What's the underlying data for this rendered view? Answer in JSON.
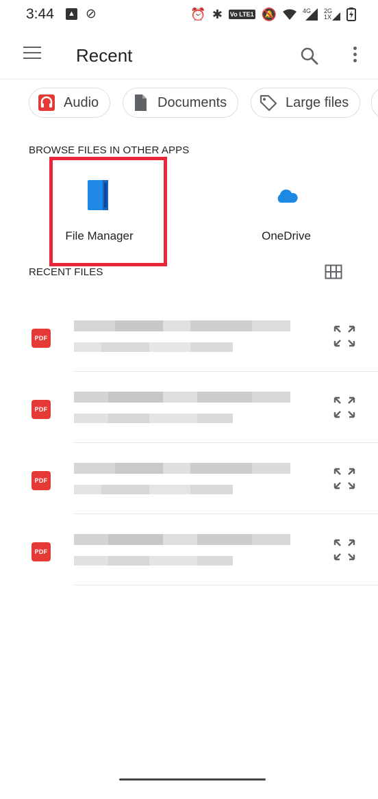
{
  "status_bar": {
    "time": "3:44",
    "left_icons": [
      "gallery-icon",
      "link-icon"
    ],
    "right_icons": [
      "alarm-icon",
      "bluetooth-vibrate-icon",
      "volte-icon",
      "mute-icon",
      "wifi-icon",
      "signal-4g-icon",
      "signal-2g-icon",
      "battery-charging-icon"
    ],
    "lte_label": "Vo LTE1",
    "net1": "4G",
    "net2": "2G",
    "net2_sub": "1X"
  },
  "toolbar": {
    "title": "Recent",
    "menu_icon": "hamburger-menu-icon",
    "search_icon": "search-icon",
    "more_icon": "more-vert-icon"
  },
  "chips": [
    {
      "label": "Audio",
      "icon": "headphones-icon",
      "color": "#e53935"
    },
    {
      "label": "Documents",
      "icon": "document-icon",
      "color": "#5f6368"
    },
    {
      "label": "Large files",
      "icon": "tag-icon",
      "color": "#5f6368"
    }
  ],
  "browse_section": {
    "title": "BROWSE FILES IN OTHER APPS",
    "apps": [
      {
        "label": "File Manager",
        "icon": "file-manager-icon",
        "color": "#1e88e5"
      },
      {
        "label": "OneDrive",
        "icon": "onedrive-cloud-icon",
        "color": "#1e88e5"
      }
    ]
  },
  "recent_section": {
    "title": "RECENT FILES",
    "grid_icon": "grid-view-icon"
  },
  "files": [
    {
      "type_badge": "PDF"
    },
    {
      "type_badge": "PDF"
    },
    {
      "type_badge": "PDF"
    },
    {
      "type_badge": "PDF"
    }
  ],
  "colors": {
    "accent_red": "#e8263c",
    "pdf_red": "#e53935",
    "onedrive_blue": "#1e88e5"
  }
}
